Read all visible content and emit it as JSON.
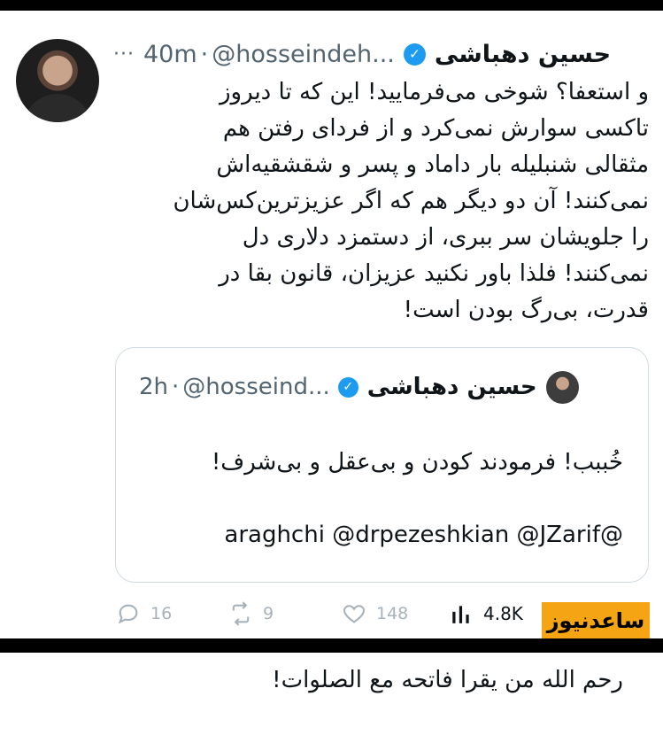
{
  "tweet": {
    "author_name": "حسین دهباشی",
    "handle": "@hosseindeh...",
    "separator": "·",
    "time": "40m",
    "more_label": "···",
    "text": "و استعفا؟ شوخی می‌فرمایید! این که تا دیروز\nتاکسی سوارش نمی‌کرد و از فردای رفتن هم\nمثقالی شنبلیله بار داماد و پسر و شقشقیه‌اش\nنمی‌کنند! آن دو دیگر هم که اگر عزیزترین‌کس‌شان\nرا جلویشان سر ببری، از دستمزد دلاری دل\nنمی‌کنند! فلذا باور نکنید عزیزان، قانون بقا در\nقدرت، بی‌رگ بودن است!"
  },
  "quoted": {
    "author_name": "حسین دهباشی",
    "handle": "@hosseind...",
    "separator": "·",
    "time": "2h",
    "line1": "خُببب! فرمودند کودن و بی‌عقل و بی‌شرف!",
    "line2": "@araghchi  @drpezeshkian @JZarif",
    "line3": "",
    "line4": "رحم الله من یقرا فاتحه مع الصلوات!"
  },
  "actions": {
    "replies": "16",
    "reposts": "9",
    "likes": "148",
    "views": "4.8K"
  },
  "watermark": {
    "text": "ساعدنیوز",
    "color": "#f5a413"
  },
  "colors": {
    "verified": "#1d9bf0",
    "secondary_text": "#536471"
  }
}
